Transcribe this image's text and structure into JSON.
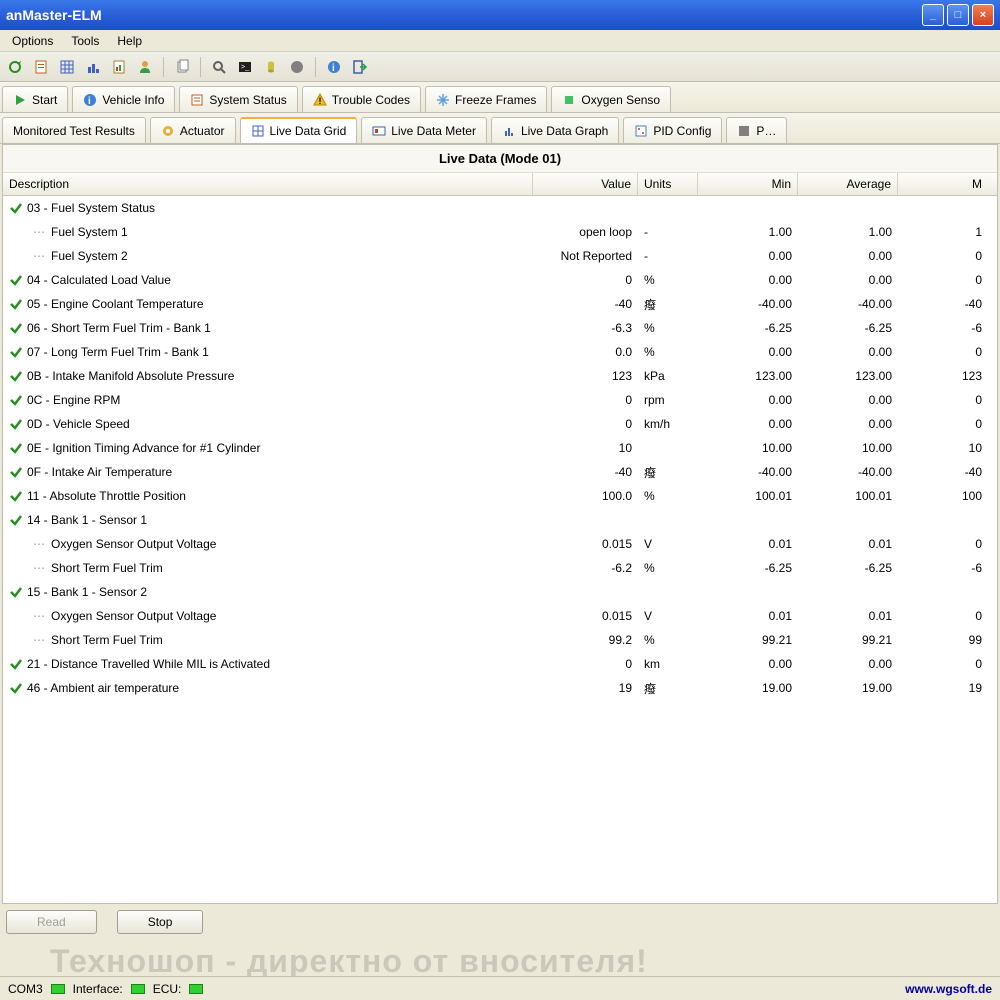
{
  "window": {
    "title": "anMaster-ELM"
  },
  "menubar": [
    "Options",
    "Tools",
    "Help"
  ],
  "tabs_row1": [
    {
      "label": "Start",
      "icon": "play"
    },
    {
      "label": "Vehicle Info",
      "icon": "info"
    },
    {
      "label": "System Status",
      "icon": "list"
    },
    {
      "label": "Trouble Codes",
      "icon": "warn"
    },
    {
      "label": "Freeze Frames",
      "icon": "freeze"
    },
    {
      "label": "Oxygen Senso",
      "icon": "o2"
    }
  ],
  "tabs_row2": [
    {
      "label": "Monitored Test Results",
      "icon": ""
    },
    {
      "label": "Actuator",
      "icon": "gear"
    },
    {
      "label": "Live Data Grid",
      "icon": "grid",
      "active": true
    },
    {
      "label": "Live Data Meter",
      "icon": "meter"
    },
    {
      "label": "Live Data Graph",
      "icon": "graph"
    },
    {
      "label": "PID Config",
      "icon": "pid"
    },
    {
      "label": "P…",
      "icon": "p"
    }
  ],
  "panel": {
    "title": "Live Data (Mode 01)"
  },
  "columns": {
    "description": "Description",
    "value": "Value",
    "units": "Units",
    "min": "Min",
    "average": "Average",
    "max": "M"
  },
  "rows": [
    {
      "type": "header",
      "check": true,
      "label": "03 - Fuel System Status"
    },
    {
      "type": "child",
      "label": "Fuel System 1",
      "value": "open loop",
      "units": "-",
      "min": "1.00",
      "avg": "1.00",
      "max": "1"
    },
    {
      "type": "child",
      "label": "Fuel System 2",
      "value": "Not Reported",
      "units": "-",
      "min": "0.00",
      "avg": "0.00",
      "max": "0"
    },
    {
      "type": "header",
      "check": true,
      "label": "04 - Calculated Load Value",
      "value": "0",
      "units": "%",
      "min": "0.00",
      "avg": "0.00",
      "max": "0"
    },
    {
      "type": "header",
      "check": true,
      "label": "05 - Engine Coolant Temperature",
      "value": "-40",
      "units": "癈",
      "min": "-40.00",
      "avg": "-40.00",
      "max": "-40"
    },
    {
      "type": "header",
      "check": true,
      "label": "06 - Short Term Fuel Trim - Bank 1",
      "value": "-6.3",
      "units": "%",
      "min": "-6.25",
      "avg": "-6.25",
      "max": "-6"
    },
    {
      "type": "header",
      "check": true,
      "label": "07 - Long Term Fuel Trim - Bank 1",
      "value": "0.0",
      "units": "%",
      "min": "0.00",
      "avg": "0.00",
      "max": "0"
    },
    {
      "type": "header",
      "check": true,
      "label": "0B - Intake Manifold Absolute Pressure",
      "value": "123",
      "units": "kPa",
      "min": "123.00",
      "avg": "123.00",
      "max": "123"
    },
    {
      "type": "header",
      "check": true,
      "label": "0C - Engine RPM",
      "value": "0",
      "units": "rpm",
      "min": "0.00",
      "avg": "0.00",
      "max": "0"
    },
    {
      "type": "header",
      "check": true,
      "label": "0D - Vehicle Speed",
      "value": "0",
      "units": "km/h",
      "min": "0.00",
      "avg": "0.00",
      "max": "0"
    },
    {
      "type": "header",
      "check": true,
      "label": "0E - Ignition Timing Advance for #1 Cylinder",
      "value": "10",
      "units": "",
      "min": "10.00",
      "avg": "10.00",
      "max": "10"
    },
    {
      "type": "header",
      "check": true,
      "label": "0F - Intake Air Temperature",
      "value": "-40",
      "units": "癈",
      "min": "-40.00",
      "avg": "-40.00",
      "max": "-40"
    },
    {
      "type": "header",
      "check": true,
      "label": "11 - Absolute Throttle Position",
      "value": "100.0",
      "units": "%",
      "min": "100.01",
      "avg": "100.01",
      "max": "100"
    },
    {
      "type": "header",
      "check": true,
      "label": "14 - Bank 1 - Sensor 1"
    },
    {
      "type": "child",
      "label": "Oxygen Sensor Output Voltage",
      "value": "0.015",
      "units": "V",
      "min": "0.01",
      "avg": "0.01",
      "max": "0"
    },
    {
      "type": "child",
      "label": "Short Term Fuel Trim",
      "value": "-6.2",
      "units": "%",
      "min": "-6.25",
      "avg": "-6.25",
      "max": "-6"
    },
    {
      "type": "header",
      "check": true,
      "label": "15 - Bank 1 - Sensor 2"
    },
    {
      "type": "child",
      "label": "Oxygen Sensor Output Voltage",
      "value": "0.015",
      "units": "V",
      "min": "0.01",
      "avg": "0.01",
      "max": "0"
    },
    {
      "type": "child",
      "label": "Short Term Fuel Trim",
      "value": "99.2",
      "units": "%",
      "min": "99.21",
      "avg": "99.21",
      "max": "99"
    },
    {
      "type": "header",
      "check": true,
      "label": "21 - Distance Travelled While MIL is Activated",
      "value": "0",
      "units": "km",
      "min": "0.00",
      "avg": "0.00",
      "max": "0"
    },
    {
      "type": "header",
      "check": true,
      "label": "46 - Ambient air temperature",
      "value": "19",
      "units": "癈",
      "min": "19.00",
      "avg": "19.00",
      "max": "19"
    }
  ],
  "buttons": {
    "read": "Read",
    "stop": "Stop"
  },
  "status": {
    "port": "COM3",
    "interface": "Interface:",
    "ecu": "ECU:",
    "url": "www.wgsoft.de"
  },
  "watermark": "Техношоп - директно от вносителя!"
}
